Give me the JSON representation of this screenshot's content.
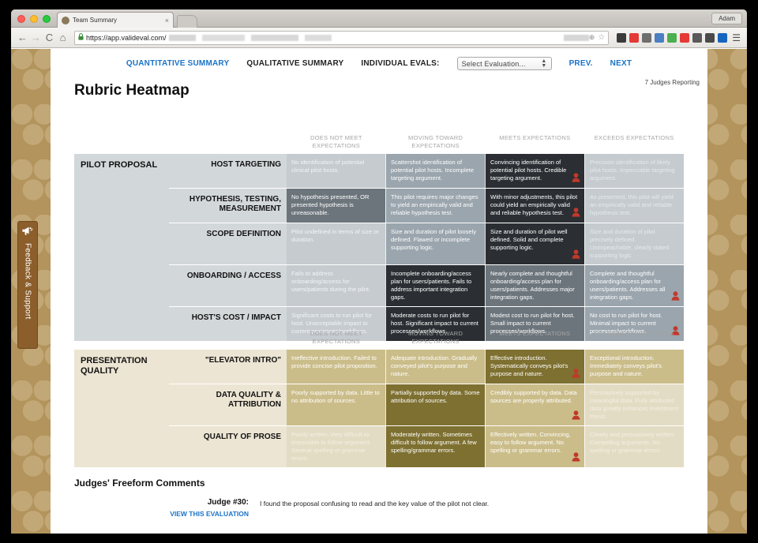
{
  "browser": {
    "tab_title": "Team Summary",
    "tab_close": "×",
    "profile_name": "Adam",
    "back_icon": "←",
    "forward_icon": "→",
    "reload_icon": "C",
    "home_icon": "⌂",
    "lock_icon": "🔒",
    "url": "https://app.valideval.com/",
    "zoom_icon": "⊕",
    "star_icon": "☆",
    "menu_icon": "☰",
    "extension_icons": [
      "pocket-icon",
      "feedly-icon",
      "evernote-icon",
      "lastpass-icon",
      "grammarly-icon",
      "adblock-icon",
      "stylish-icon",
      "pinterest-icon",
      "download-icon"
    ],
    "extension_colors": [
      "#3b3b3b",
      "#e53935",
      "#6e6e6e",
      "#4a7fc1",
      "#4caf50",
      "#e53935",
      "#5a5a5a",
      "#4a4a4a",
      "#1565c0"
    ]
  },
  "feedback": {
    "label": "Feedback & Support",
    "icon": "megaphone-icon"
  },
  "nav": {
    "quantitative": "QUANTITATIVE SUMMARY",
    "qualitative": "QUALITATIVE SUMMARY",
    "individual_evals_label": "INDIVIDUAL EVALS:",
    "select_value": "Select Evaluation...",
    "prev": "PREV.",
    "next": "NEXT"
  },
  "header": {
    "title": "Rubric Heatmap",
    "judges_reporting": "7 Judges Reporting"
  },
  "columns": [
    "DOES NOT MEET EXPECTATIONS",
    "MOVING TOWARD EXPECTATIONS",
    "MEETS EXPECTATIONS",
    "EXCEEDS EXPECTATIONS"
  ],
  "chart_data": {
    "type": "heatmap",
    "title": "Rubric Heatmap",
    "xlabel": "",
    "ylabel": "",
    "categories": [
      "DOES NOT MEET EXPECTATIONS",
      "MOVING TOWARD EXPECTATIONS",
      "MEETS EXPECTATIONS",
      "EXCEEDS EXPECTATIONS"
    ],
    "judges_reporting": 7,
    "groups": [
      {
        "name": "PILOT PROPOSAL",
        "rows": [
          {
            "criterion": "HOST TARGETING",
            "selected_index": 2,
            "intensity": [
              0,
              1,
              3,
              0
            ]
          },
          {
            "criterion": "HYPOTHESIS, TESTING, MEASUREMENT",
            "selected_index": 2,
            "intensity": [
              0,
              1,
              3,
              0
            ]
          },
          {
            "criterion": "SCOPE DEFINITION",
            "selected_index": 2,
            "intensity": [
              0,
              1,
              3,
              0
            ]
          },
          {
            "criterion": "ONBOARDING / ACCESS",
            "selected_index": 3,
            "intensity": [
              0,
              3,
              1,
              1
            ]
          },
          {
            "criterion": "HOST'S COST / IMPACT",
            "selected_index": 3,
            "intensity": [
              0,
              3,
              1,
              1
            ]
          }
        ]
      },
      {
        "name": "PRESENTATION QUALITY",
        "rows": [
          {
            "criterion": "\"ELEVATOR INTRO\"",
            "selected_index": 2,
            "intensity": [
              0,
              2,
              3,
              0
            ]
          },
          {
            "criterion": "DATA QUALITY & ATTRIBUTION",
            "selected_index": 3,
            "intensity": [
              0,
              3,
              2,
              0
            ]
          },
          {
            "criterion": "QUALITY OF PROSE",
            "selected_index": 2,
            "intensity": [
              0,
              3,
              2,
              0
            ]
          }
        ]
      }
    ]
  },
  "groups": [
    {
      "name": "PILOT PROPOSAL",
      "rows": [
        {
          "criterion": "HOST TARGETING",
          "cells": [
            {
              "text": "No identification of potential clinical pilot hosts.",
              "level": "lvl0",
              "judge": false
            },
            {
              "text": "Scattershot identification of potential pilot hosts. Incomplete targeting argument.",
              "level": "lvl1",
              "judge": false
            },
            {
              "text": "Convincing identification of potential pilot hosts. Credible targeting argument.",
              "level": "sel",
              "judge": true
            },
            {
              "text": "Precision identification of likely pilot hosts. Impeccable targeting argument.",
              "level": "lvl3",
              "judge": false
            }
          ]
        },
        {
          "criterion": "HYPOTHESIS, TESTING, MEASUREMENT",
          "cells": [
            {
              "text": "No hypothesis presented, OR presented hypothesis is unreasonable.",
              "level": "mid",
              "judge": false
            },
            {
              "text": "This pilot requires major changes to yield an empirically valid and reliable hypothesis test.",
              "level": "lvl1",
              "judge": false
            },
            {
              "text": "With minor adjustments, this pilot could yield an empirically valid and reliable hypothesis test.",
              "level": "sel",
              "judge": true
            },
            {
              "text": "As presented, this pilot will yield an empirically valid and reliable hypothesis test.",
              "level": "lvl3",
              "judge": false
            }
          ]
        },
        {
          "criterion": "SCOPE DEFINITION",
          "cells": [
            {
              "text": "Pilot undefined in terms of size or duration.",
              "level": "lvl0",
              "judge": false
            },
            {
              "text": "Size and duration of pilot loosely defined. Flawed or incomplete supporting logic.",
              "level": "lvl1",
              "judge": false
            },
            {
              "text": "Size and duration of pilot well defined. Solid and complete supporting logic.",
              "level": "sel",
              "judge": true
            },
            {
              "text": "Size and duration of pilot precisely defined. Unimpeachable, clearly stated supporting logic.",
              "level": "lvl3",
              "judge": false
            }
          ]
        },
        {
          "criterion": "ONBOARDING / ACCESS",
          "cells": [
            {
              "text": "Fails to address onboarding/access for users/patients during the pilot.",
              "level": "lvl0",
              "judge": false
            },
            {
              "text": "Incomplete onboarding/access plan for users/patients. Fails to address important integration gaps.",
              "level": "sel",
              "judge": false
            },
            {
              "text": "Nearly complete and thoughtful onboarding/access plan for users/patients. Addresses major integration gaps.",
              "level": "mid",
              "judge": false
            },
            {
              "text": "Complete and thoughtful onboarding/access plan for users/patients. Addresses all integration gaps.",
              "level": "lvl1",
              "judge": true
            }
          ]
        },
        {
          "criterion": "HOST'S COST / IMPACT",
          "cells": [
            {
              "text": "Significant costs to run pilot for host. Unacceptable impact to current processes/workflows.",
              "level": "lvl0",
              "judge": false
            },
            {
              "text": "Moderate costs to run pilot for host. Significant impact to current processes/workflows.",
              "level": "sel",
              "judge": false
            },
            {
              "text": "Modest cost to run pilot for host. Small impact to current processes/workflows.",
              "level": "mid",
              "judge": false
            },
            {
              "text": "No cost to run pilot for host. Minimal impact to current processes/workflows.",
              "level": "lvl1",
              "judge": true
            }
          ]
        }
      ]
    },
    {
      "name": "PRESENTATION QUALITY",
      "rows": [
        {
          "criterion": "\"ELEVATOR INTRO\"",
          "cells": [
            {
              "text": "Ineffective introduction. Failed to provide concise pilot proposition.",
              "level": "lvl2",
              "judge": false
            },
            {
              "text": "Adequate introduction. Gradually conveyed pilot's purpose and nature.",
              "level": "lvl2",
              "judge": false
            },
            {
              "text": "Effective introduction. Systematically conveys pilot's purpose and nature.",
              "level": "sel",
              "judge": true
            },
            {
              "text": "Exceptional introduction. Immediately conveys pilot's purpose and nature.",
              "level": "lvl2",
              "judge": false
            }
          ]
        },
        {
          "criterion": "DATA QUALITY & ATTRIBUTION",
          "cells": [
            {
              "text": "Poorly supported by data. Little to no attribution of sources.",
              "level": "lvl2",
              "judge": false
            },
            {
              "text": "Partially supported by data. Some attribution of sources.",
              "level": "sel",
              "judge": false
            },
            {
              "text": "Credibly supported by data. Data sources are properly attributed.",
              "level": "lvl2",
              "judge": true
            },
            {
              "text": "Persuasively supported by meaningful data. Fully attributed data greatly enhances investment thesis.",
              "level": "lvl3",
              "judge": false
            }
          ]
        },
        {
          "criterion": "QUALITY OF PROSE",
          "cells": [
            {
              "text": "Poorly written. Very difficult to impossible to follow argument. Several spelling or grammar errors.",
              "level": "lvl3",
              "judge": false
            },
            {
              "text": "Moderately written. Sometimes difficult to follow argument. A few spelling/grammar errors.",
              "level": "sel",
              "judge": false
            },
            {
              "text": "Effectively written. Convincing, easy to follow argument. No spelling or grammar errors.",
              "level": "lvl2",
              "judge": true
            },
            {
              "text": "Clearly and persuasively written. Compelling arguments. No spelling or grammar errors.",
              "level": "lvl3",
              "judge": false
            }
          ]
        }
      ]
    }
  ],
  "comments": {
    "title": "Judges' Freeform Comments",
    "entries": [
      {
        "judge": "Judge #30:",
        "link": "VIEW THIS EVALUATION",
        "text": "I found the proposal confusing to read and the key value of the pilot not clear."
      }
    ]
  },
  "colors": {
    "accent_blue": "#1a73c7",
    "judge_red": "#c0392b",
    "page_bg_tan": "#b2945c",
    "feedback_brown": "#8b5e2b"
  }
}
